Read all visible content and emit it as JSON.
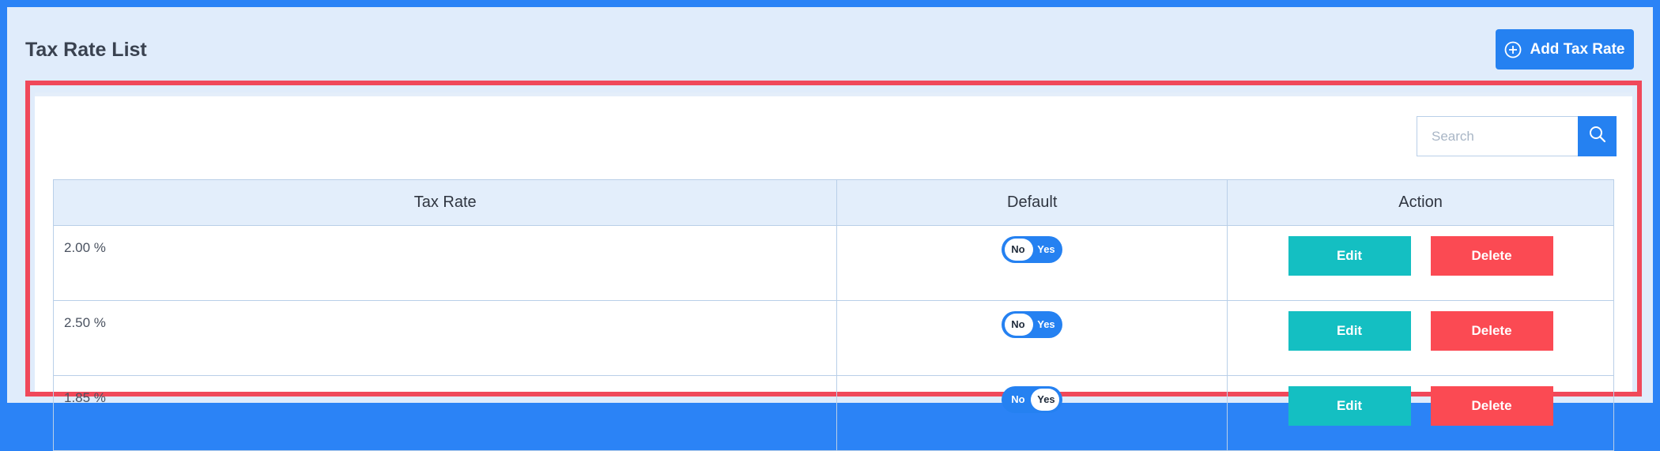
{
  "page": {
    "title": "Tax Rate List"
  },
  "header": {
    "add_button_label": "Add Tax Rate"
  },
  "search": {
    "placeholder": "Search",
    "value": ""
  },
  "table": {
    "headers": {
      "rate": "Tax Rate",
      "default": "Default",
      "action": "Action"
    },
    "rows": [
      {
        "rate": "2.00 %",
        "toggle_no": "No",
        "toggle_yes": "Yes",
        "selected": "no",
        "edit": "Edit",
        "delete": "Delete"
      },
      {
        "rate": "2.50 %",
        "toggle_no": "No",
        "toggle_yes": "Yes",
        "selected": "no",
        "edit": "Edit",
        "delete": "Delete"
      },
      {
        "rate": "1.85 %",
        "toggle_no": "No",
        "toggle_yes": "Yes",
        "selected": "yes",
        "edit": "Edit",
        "delete": "Delete"
      }
    ]
  },
  "colors": {
    "primary": "#2581f1",
    "edit": "#14bfc2",
    "delete": "#fb4a53",
    "highlight": "#f0485a"
  },
  "icons": {
    "add": "plus-circle-icon",
    "search": "search-icon"
  }
}
